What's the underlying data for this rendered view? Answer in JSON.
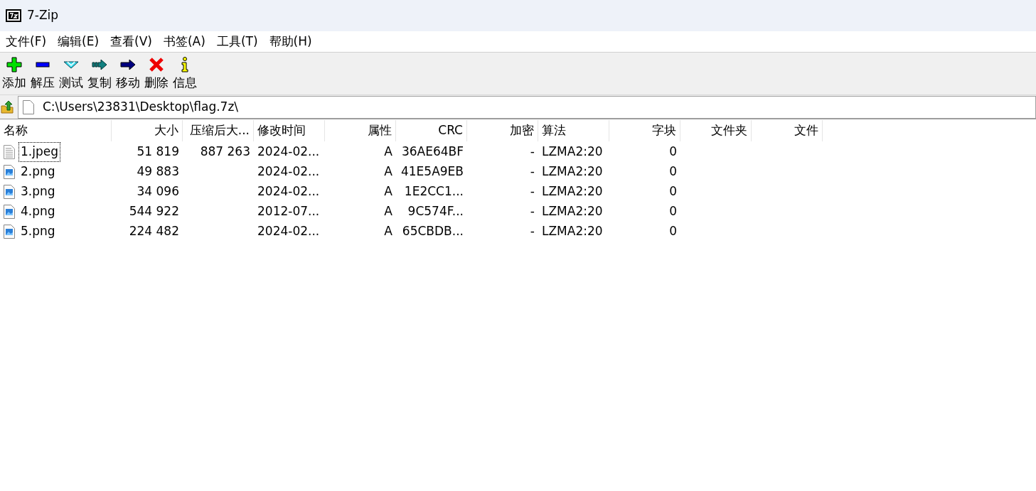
{
  "window": {
    "title": "7-Zip"
  },
  "menu": [
    "文件(F)",
    "编辑(E)",
    "查看(V)",
    "书签(A)",
    "工具(T)",
    "帮助(H)"
  ],
  "toolbar": [
    {
      "kind": "add",
      "label": "添加"
    },
    {
      "kind": "extract",
      "label": "解压"
    },
    {
      "kind": "test",
      "label": "测试"
    },
    {
      "kind": "copy",
      "label": "复制"
    },
    {
      "kind": "move",
      "label": "移动"
    },
    {
      "kind": "delete",
      "label": "删除"
    },
    {
      "kind": "info",
      "label": "信息"
    }
  ],
  "address": {
    "value": "C:\\Users\\23831\\Desktop\\flag.7z\\"
  },
  "table": {
    "columns": [
      "名称",
      "大小",
      "压缩后大...",
      "修改时间",
      "属性",
      "CRC",
      "加密",
      "算法",
      "字块",
      "文件夹",
      "文件"
    ],
    "rows": [
      {
        "kind": "text",
        "focused": true,
        "cells": [
          "1.jpeg",
          "51 819",
          "887 263",
          "2024-02...",
          "A",
          "36AE64BF",
          "-",
          "LZMA2:20",
          "0"
        ]
      },
      {
        "kind": "image",
        "focused": false,
        "cells": [
          "2.png",
          "49 883",
          "",
          "2024-02...",
          "A",
          "41E5A9EB",
          "-",
          "LZMA2:20",
          "0"
        ]
      },
      {
        "kind": "image",
        "focused": false,
        "cells": [
          "3.png",
          "34 096",
          "",
          "2024-02...",
          "A",
          "1E2CC1...",
          "-",
          "LZMA2:20",
          "0"
        ]
      },
      {
        "kind": "image",
        "focused": false,
        "cells": [
          "4.png",
          "544 922",
          "",
          "2012-07...",
          "A",
          "9C574F...",
          "-",
          "LZMA2:20",
          "0"
        ]
      },
      {
        "kind": "image",
        "focused": false,
        "cells": [
          "5.png",
          "224 482",
          "",
          "2024-02...",
          "A",
          "65CBDB...",
          "-",
          "LZMA2:20",
          "0"
        ]
      }
    ]
  }
}
